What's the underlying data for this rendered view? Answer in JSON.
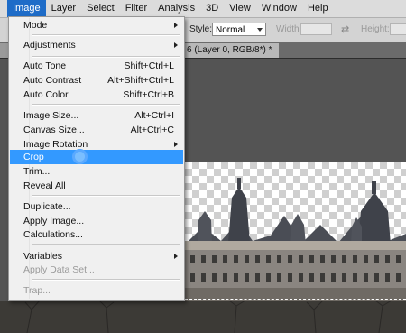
{
  "menubar": {
    "items": [
      {
        "label": "Image",
        "active": true
      },
      {
        "label": "Layer",
        "active": false
      },
      {
        "label": "Select",
        "active": false
      },
      {
        "label": "Filter",
        "active": false
      },
      {
        "label": "Analysis",
        "active": false
      },
      {
        "label": "3D",
        "active": false
      },
      {
        "label": "View",
        "active": false
      },
      {
        "label": "Window",
        "active": false
      },
      {
        "label": "Help",
        "active": false
      }
    ]
  },
  "options": {
    "style_label": "Style:",
    "style_value": "Normal",
    "width_label": "Width:",
    "height_label": "Height:"
  },
  "document": {
    "tab_title": "6 (Layer 0, RGB/8*) *"
  },
  "image_menu": {
    "items": [
      {
        "label": "Mode",
        "shortcut": "",
        "submenu": true,
        "disabled": false
      },
      {
        "label": "Adjustments",
        "shortcut": "",
        "submenu": true,
        "disabled": false
      },
      {
        "label": "Auto Tone",
        "shortcut": "Shift+Ctrl+L",
        "submenu": false,
        "disabled": false
      },
      {
        "label": "Auto Contrast",
        "shortcut": "Alt+Shift+Ctrl+L",
        "submenu": false,
        "disabled": false
      },
      {
        "label": "Auto Color",
        "shortcut": "Shift+Ctrl+B",
        "submenu": false,
        "disabled": false
      },
      {
        "label": "Image Size...",
        "shortcut": "Alt+Ctrl+I",
        "submenu": false,
        "disabled": false
      },
      {
        "label": "Canvas Size...",
        "shortcut": "Alt+Ctrl+C",
        "submenu": false,
        "disabled": false
      },
      {
        "label": "Image Rotation",
        "shortcut": "",
        "submenu": true,
        "disabled": false
      },
      {
        "label": "Crop",
        "shortcut": "",
        "submenu": false,
        "disabled": false,
        "highlighted": true
      },
      {
        "label": "Trim...",
        "shortcut": "",
        "submenu": false,
        "disabled": false
      },
      {
        "label": "Reveal All",
        "shortcut": "",
        "submenu": false,
        "disabled": false
      },
      {
        "label": "Duplicate...",
        "shortcut": "",
        "submenu": false,
        "disabled": false
      },
      {
        "label": "Apply Image...",
        "shortcut": "",
        "submenu": false,
        "disabled": false
      },
      {
        "label": "Calculations...",
        "shortcut": "",
        "submenu": false,
        "disabled": false
      },
      {
        "label": "Variables",
        "shortcut": "",
        "submenu": true,
        "disabled": false
      },
      {
        "label": "Apply Data Set...",
        "shortcut": "",
        "submenu": false,
        "disabled": true
      },
      {
        "label": "Trap...",
        "shortcut": "",
        "submenu": false,
        "disabled": true
      }
    ]
  },
  "icons": {
    "swap": "swap-arrows-icon",
    "cursor": "busy-cursor-icon",
    "submenu": "chevron-right-icon"
  },
  "colors": {
    "menu_highlight": "#3399ff",
    "menubar_active": "#1e6cc8",
    "disabled_text": "#9a9a9a"
  }
}
